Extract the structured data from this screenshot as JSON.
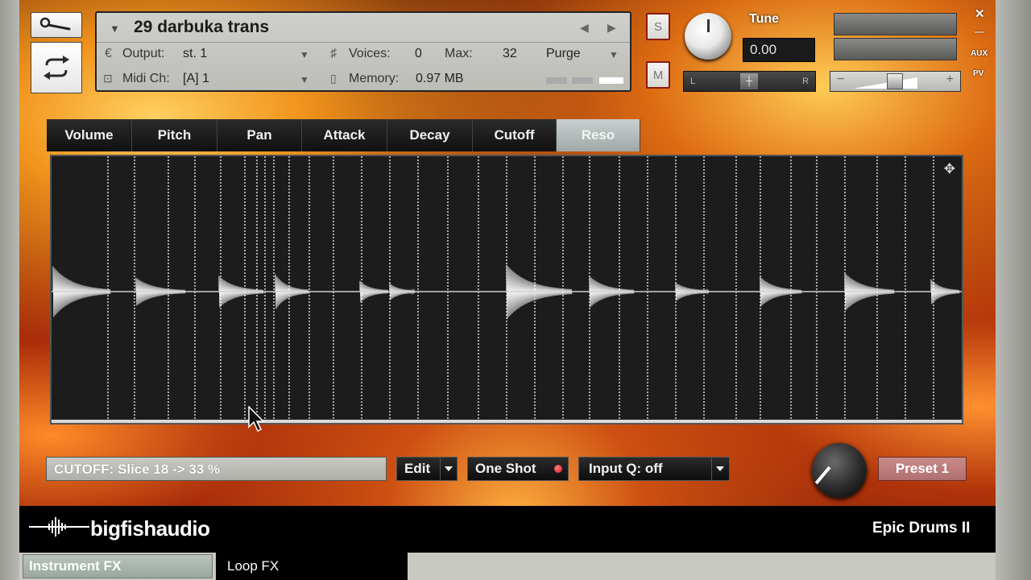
{
  "header": {
    "instrument_name": "29 darbuka trans",
    "output_label": "Output:",
    "output_value": "st. 1",
    "midi_label": "Midi Ch:",
    "midi_value": "[A]  1",
    "voices_label": "Voices:",
    "voices_value": "0",
    "max_label": "Max:",
    "max_value": "32",
    "purge_label": "Purge",
    "memory_label": "Memory:",
    "memory_value": "0.97 MB"
  },
  "solo_label": "S",
  "mute_label": "M",
  "tune": {
    "label": "Tune",
    "value": "0.00"
  },
  "pan": {
    "left": "L",
    "right": "R"
  },
  "side_labels": {
    "close": "✕",
    "minimize": "—",
    "aux": "AUX",
    "pv": "PV"
  },
  "tabs": [
    "Volume",
    "Pitch",
    "Pan",
    "Attack",
    "Decay",
    "Cutoff",
    "Reso"
  ],
  "active_tab": "Reso",
  "status_text": "CUTOFF: Slice 18 -> 33 %",
  "controls": {
    "edit_label": "Edit",
    "one_shot_label": "One Shot",
    "input_q_label": "Input Q: off",
    "preset_label": "Preset 1"
  },
  "brand": "bigfishaudio",
  "product_name": "Epic Drums II",
  "bottom_tabs": [
    "Instrument FX",
    "Loop FX"
  ],
  "colors": {
    "accent_active_tab": "#b7c0c0",
    "preset_button": "#c08080",
    "record_dot": "#e01020"
  },
  "icons": {
    "tool": "wrench-icon",
    "loop": "loop-arrows-icon",
    "expand": "expand-arrows-icon"
  }
}
